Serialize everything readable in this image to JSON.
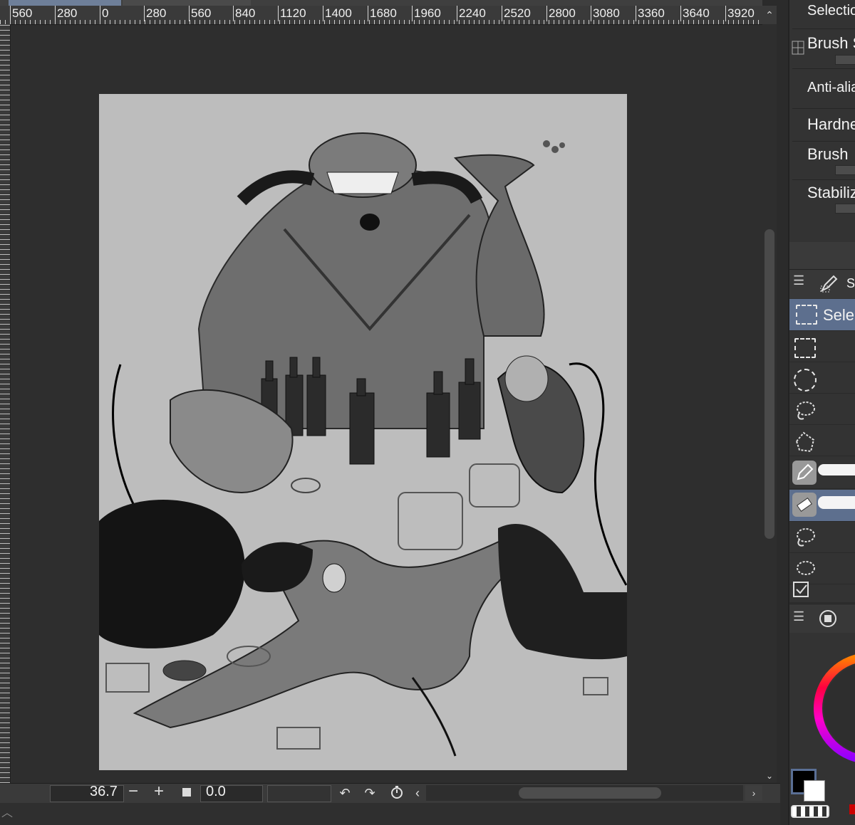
{
  "ruler": {
    "labels": [
      "560",
      "280",
      "0",
      "280",
      "560",
      "840",
      "1120",
      "1400",
      "1680",
      "1960",
      "2240",
      "2520",
      "2800",
      "3080",
      "3360",
      "3640",
      "3920"
    ]
  },
  "canvas": {
    "zoom": "36.7",
    "angle": "0.0",
    "zoom_minus": "−",
    "zoom_plus": "+"
  },
  "tool_property": {
    "title": "Selection",
    "brush_size": "Brush S",
    "anti_alias": "Anti-alias",
    "hardness": "Hardne",
    "brush_density": "Brush",
    "stabilization": "Stabiliz"
  },
  "subtool": {
    "header_label": "Se",
    "active_item": "Sele"
  },
  "colors": {
    "accent": "#5d6f8e",
    "main_color": "#000000",
    "sub_color": "#ffffff"
  },
  "icons": {
    "undo": "↶",
    "redo": "↷",
    "scroll_up": "⌃",
    "scroll_down": "⌄",
    "scroll_left": "‹",
    "scroll_right": "›",
    "expand": "︿"
  }
}
